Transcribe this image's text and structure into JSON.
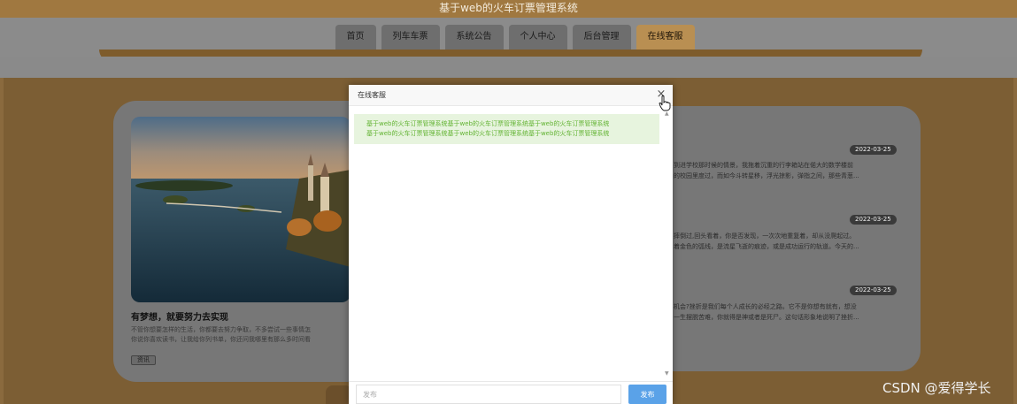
{
  "header": {
    "site_title": "基于web的火车订票管理系统"
  },
  "nav": {
    "items": [
      {
        "label": "首页"
      },
      {
        "label": "列车车票"
      },
      {
        "label": "系统公告"
      },
      {
        "label": "个人中心"
      },
      {
        "label": "后台管理"
      },
      {
        "label": "在线客服"
      }
    ],
    "active_index": 5
  },
  "feature_card": {
    "title": "有梦想，就要努力去实现",
    "desc_lines": [
      "不管你想要怎样的生活，你都要去努力争取，不多尝试一些事情怎",
      "你说你喜欢读书，让我给你列书单，你还问我哪里有那么多时间看"
    ],
    "tag": "资讯"
  },
  "news": [
    {
      "date": "2022-03-25",
      "lines": [
        "到进学校那时候的情景，我拖着沉重的行李箱站在偌大的数学楼前",
        "的校园里度过，而如今斗转星移，浮光掠影，弹指之间，那些青葱..."
      ]
    },
    {
      "date": "2022-03-25",
      "lines": [
        "摔倒过,回头看着，你是否发现，一次次地重复着，却从没爬起过。",
        "着金色的弧线，是流星飞逝的痕迹，或是成功运行的轨道。今天的..."
      ]
    },
    {
      "date": "2022-03-25",
      "lines": [
        "机会?挫折是我们每个人成长的必经之路。它不是你想有就有，想没",
        "一生摆脱苦难，你就得是神或者是死尸。这句话形象地说明了挫折..."
      ]
    }
  ],
  "dialog": {
    "title": "在线客服",
    "close_glyph": "×",
    "messages": [
      {
        "lines": [
          "基于web的火车订票管理系统基于web的火车订票管理系统基于web的火车订票管理系统",
          "基于web的火车订票管理系统基于web的火车订票管理系统基于web的火车订票管理系统"
        ]
      }
    ],
    "input": {
      "value": "",
      "placeholder": "发布"
    },
    "submit_label": "发布"
  },
  "watermark": "CSDN @爱得学长",
  "colors": {
    "accent_button": "#5aa2e8",
    "message_bg": "#e7f4de",
    "message_text": "#62b332",
    "nav_active": "#b98f52"
  },
  "icons": {
    "close": "close-icon",
    "cursor": "hand-pointer-icon",
    "scroll_up": "scroll-up-icon",
    "scroll_down": "scroll-down-icon"
  }
}
